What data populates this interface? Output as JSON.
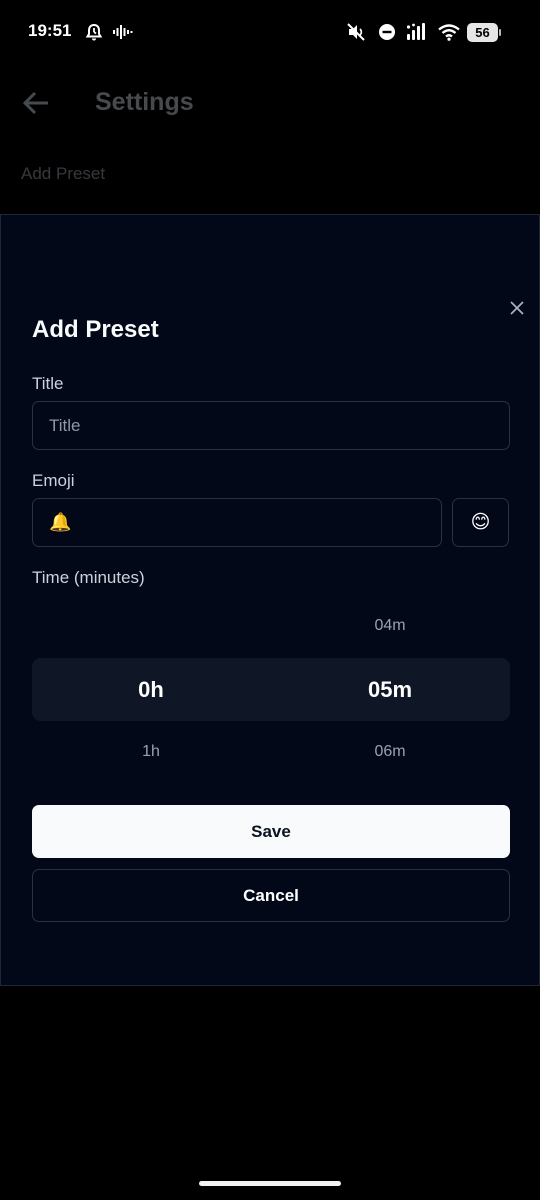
{
  "status_bar": {
    "time": "19:51",
    "battery_level": "56",
    "icons": [
      "alarm-icon",
      "voice-wave-icon",
      "mute-icon",
      "do-not-disturb-icon",
      "signal-icon",
      "wifi-icon",
      "battery-icon"
    ]
  },
  "background_app": {
    "title": "Settings",
    "section": "Add Preset"
  },
  "modal": {
    "title": "Add Preset",
    "title_label": "Title",
    "title_placeholder": "Title",
    "title_value": "",
    "emoji_label": "Emoji",
    "emoji_value": "🔔",
    "emoji_picker_glyph": "😊",
    "time_label": "Time (minutes)",
    "hours": {
      "above": "",
      "selected": "0h",
      "below": "1h"
    },
    "minutes": {
      "above": "04m",
      "selected": "05m",
      "below": "06m"
    },
    "save_label": "Save",
    "cancel_label": "Cancel"
  },
  "colors": {
    "modal_bg": "#020817",
    "border": "#273244",
    "picker_highlight": "#0f1626",
    "primary_button": "#f8fafc"
  }
}
